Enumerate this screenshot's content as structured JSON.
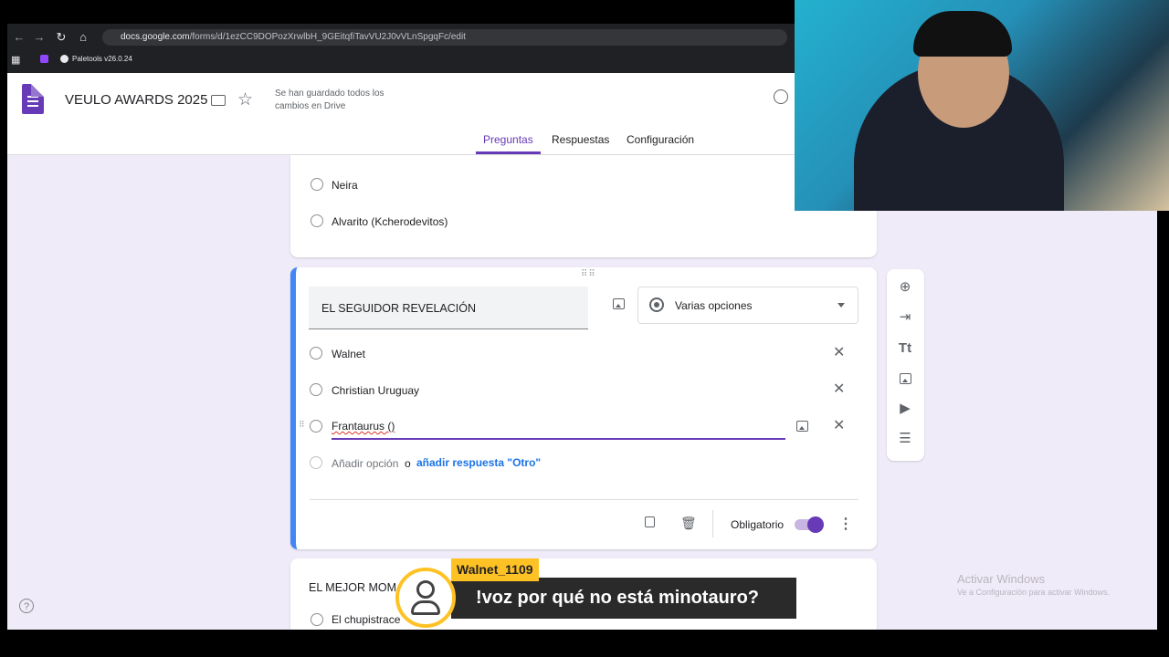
{
  "browser": {
    "url_domain": "docs.google.com",
    "url_path": "/forms/d/1ezCC9DOPozXrwlbH_9GEitqfiTavVU2J0vVLnSpgqFc/edit",
    "bookmark": "Paletools v26.0.24"
  },
  "header": {
    "title": "VEULO AWARDS 2025",
    "saved_line1": "Se han guardado todos los",
    "saved_line2": "cambios en Drive",
    "tabs": [
      "Preguntas",
      "Respuestas",
      "Configuración"
    ]
  },
  "prev_question": {
    "options": [
      "Neira",
      "Alvarito (Kcherodevitos)"
    ]
  },
  "active_question": {
    "title": "EL SEGUIDOR REVELACIÓN",
    "type": "Varias opciones",
    "options": [
      "Walnet",
      "Christian Uruguay"
    ],
    "editing_option": "Frantaurus ()",
    "add_option": "Añadir opción",
    "or": "o",
    "add_other": "añadir respuesta \"Otro\"",
    "required_label": "Obligatorio",
    "required": true
  },
  "next_question": {
    "title": "EL MEJOR MOM",
    "first_option": "El chupistrace"
  },
  "windows": {
    "activate_title": "Activar Windows",
    "activate_sub": "Ve a Configuración para activar Windows."
  },
  "chat": {
    "user": "Walnet_1109",
    "message": "!voz por qué no está minotauro?"
  },
  "colors": {
    "accent": "#673ab7",
    "active_border": "#4285f4",
    "chat_yellow": "#ffc225"
  }
}
